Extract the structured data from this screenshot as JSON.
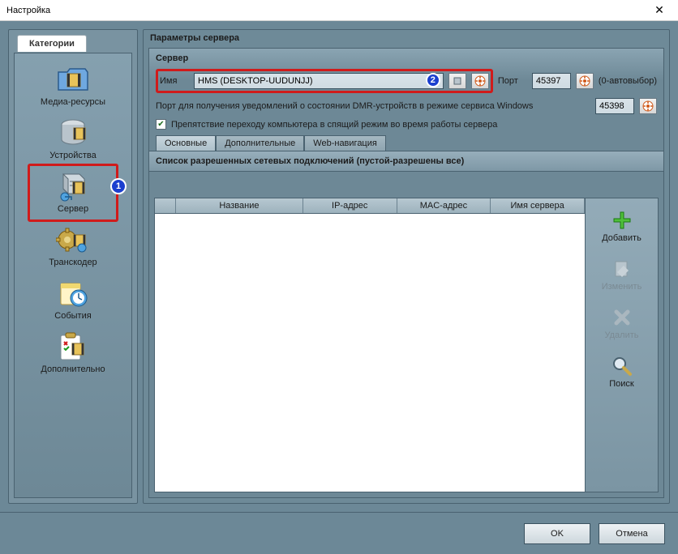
{
  "window": {
    "title": "Настройка"
  },
  "sidebar": {
    "tab": "Категории",
    "items": [
      {
        "label": "Медиа-ресурсы"
      },
      {
        "label": "Устройства"
      },
      {
        "label": "Сервер"
      },
      {
        "label": "Транскодер"
      },
      {
        "label": "События"
      },
      {
        "label": "Дополнительно"
      }
    ],
    "highlight_badge": "1"
  },
  "main": {
    "title": "Параметры сервера",
    "server_group": "Сервер",
    "name_label": "Имя",
    "name_value": "HMS (DESKTOP-UUDUNJJ)",
    "name_badge": "2",
    "port_label": "Порт",
    "port_value": "45397",
    "port_hint": "(0-автовыбор)",
    "dmr_label": "Порт для получения уведомлений о состоянии DMR-устройств в режиме сервиса Windows",
    "dmr_value": "45398",
    "sleep_check": "Препятствие переходу компьютера в спящий режим во время работы сервера",
    "tabs": [
      {
        "label": "Основные"
      },
      {
        "label": "Дополнительные"
      },
      {
        "label": "Web-навигация"
      }
    ],
    "list_title": "Список разрешенных сетевых подключений (пустой-разрешены все)",
    "columns": [
      {
        "label": "Название"
      },
      {
        "label": "IP-адрес"
      },
      {
        "label": "MAC-адрес"
      },
      {
        "label": "Имя сервера"
      }
    ],
    "actions": {
      "add": "Добавить",
      "edit": "Изменить",
      "del": "Удалить",
      "search": "Поиск"
    }
  },
  "footer": {
    "ok": "OK",
    "cancel": "Отмена"
  }
}
